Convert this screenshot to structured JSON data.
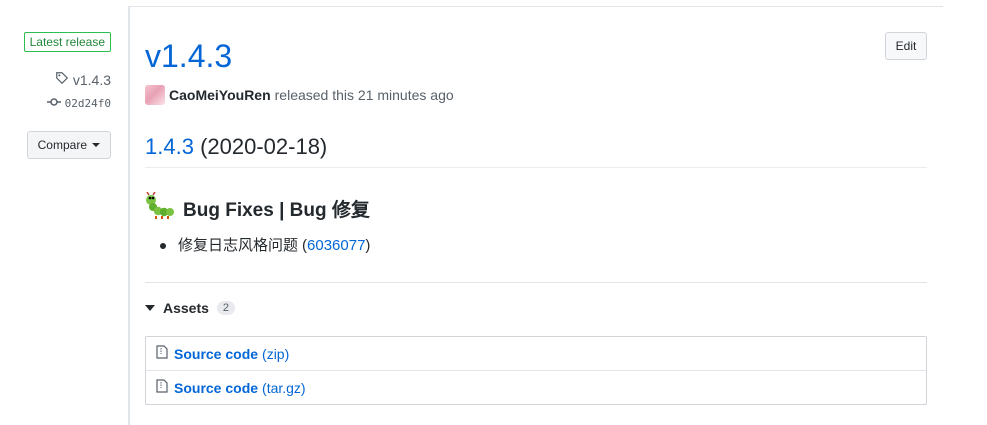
{
  "sidebar": {
    "badge": "Latest release",
    "tag": "v1.4.3",
    "commit": "02d24f0",
    "compare_label": "Compare"
  },
  "release": {
    "title": "v1.4.3",
    "edit_label": "Edit",
    "author": "CaoMeiYouRen",
    "released_text": "released this 21 minutes ago"
  },
  "notes": {
    "version_link": "1.4.3",
    "version_date": "(2020-02-18)",
    "section_title": "Bug Fixes | Bug 修复",
    "item_text": "修复日志风格问题",
    "item_open": "(",
    "item_commit": "6036077",
    "item_close": ")"
  },
  "assets": {
    "label": "Assets",
    "count": "2",
    "items": [
      {
        "name": "Source code",
        "ext": "(zip)"
      },
      {
        "name": "Source code",
        "ext": "(tar.gz)"
      }
    ]
  },
  "colors": {
    "link": "#0366d6",
    "badge_green": "#2cbe4e"
  }
}
